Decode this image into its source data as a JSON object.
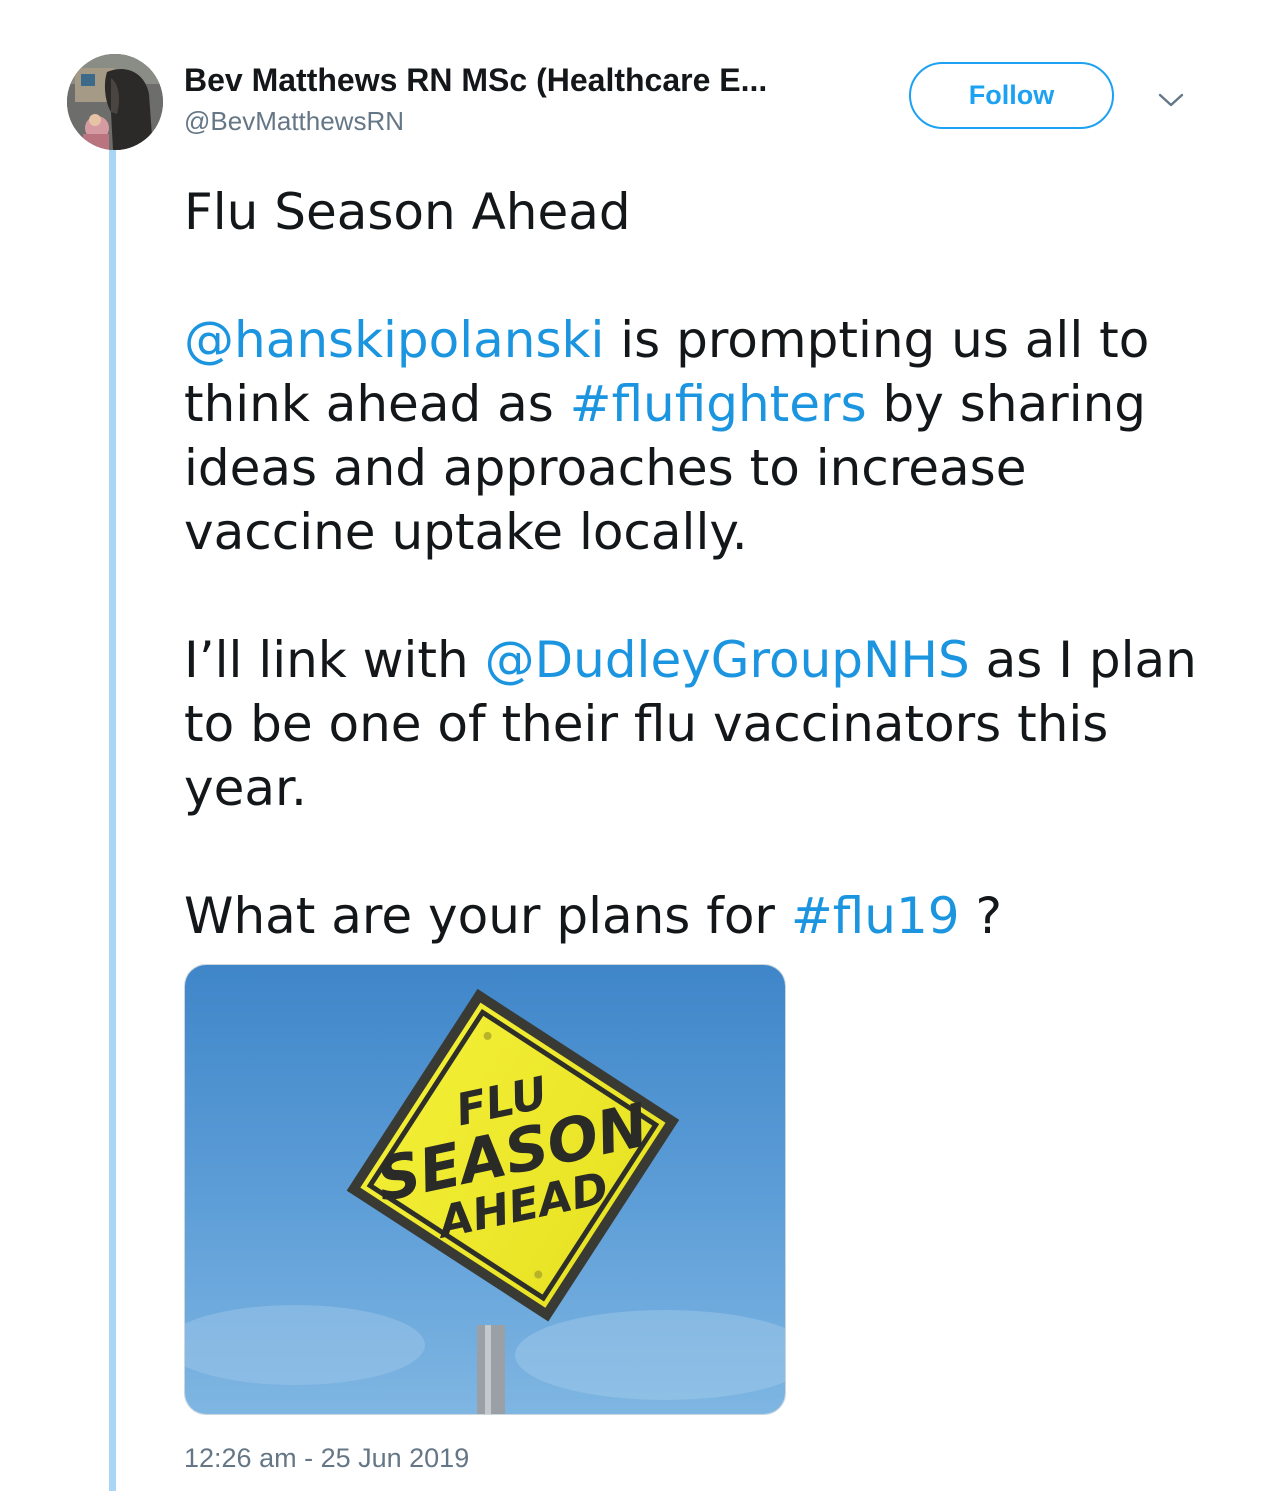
{
  "author": {
    "display_name": "Bev Matthews RN MSc (Healthcare E...",
    "handle": "@BevMatthewsRN",
    "avatar_icon": "profile-photo-avatar"
  },
  "header": {
    "follow_label": "Follow",
    "more_icon": "chevron-down-icon"
  },
  "tweet": {
    "line1": "Flu Season Ahead",
    "p2": {
      "mention": "@hanskipolanski",
      "t1": " is prompting us all to think ahead as ",
      "hashtag": "#flufighters",
      "t2": " by sharing ideas and approaches to increase vaccine uptake locally."
    },
    "p3": {
      "t1": "I’ll link with ",
      "mention": "@DudleyGroupNHS",
      "t2": " as I plan to be one of their flu vaccinators this year."
    },
    "p4": {
      "t1": "What are your plans for ",
      "hashtag": "#flu19",
      "t2": " ?"
    }
  },
  "media": {
    "sign_line1": "FLU",
    "sign_line2": "SEASON",
    "sign_line3": "AHEAD"
  },
  "meta": {
    "time": "12:26 am",
    "separator": " - ",
    "date": "25 Jun 2019"
  },
  "colors": {
    "link": "#1b95e0",
    "follow_border": "#1da1f2",
    "thread_line": "#a9d6f5",
    "muted": "#657786"
  }
}
